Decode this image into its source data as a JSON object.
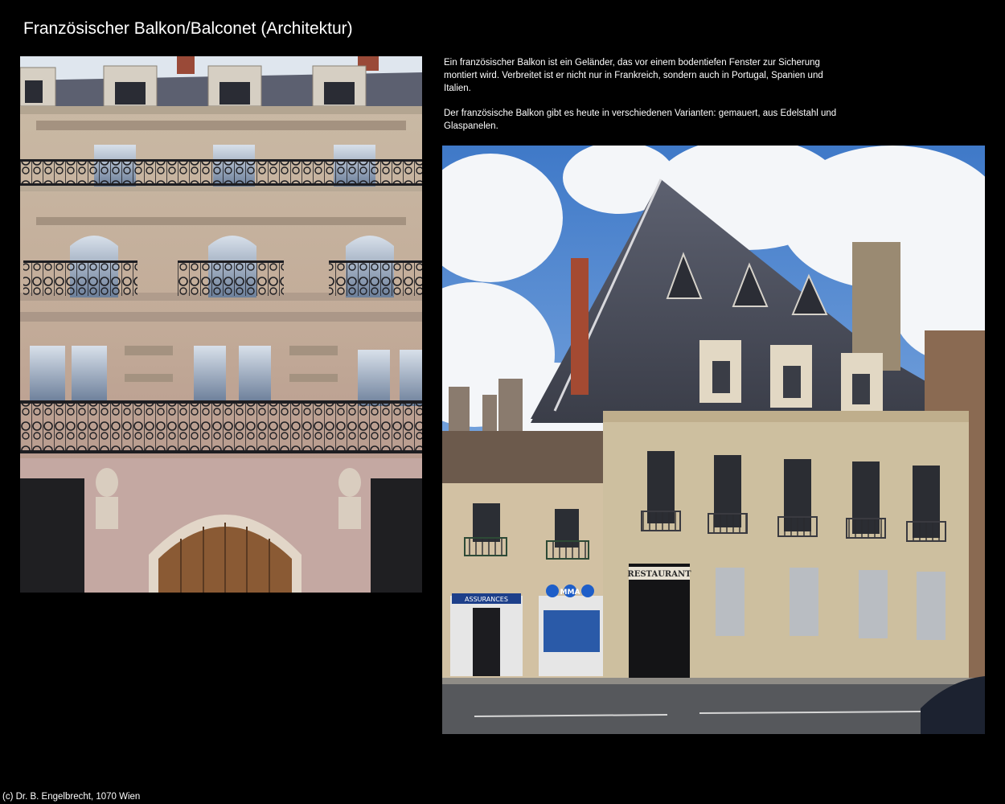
{
  "page": {
    "title": "Französischer Balkon/Balconet (Architektur)",
    "footer": "(c) Dr. B. Engelbrecht, 1070 Wien"
  },
  "description": {
    "paragraph_1": "Ein französischer Balkon ist ein Geländer, das vor einem bodentiefen Fenster zur Sicherung montiert wird. Verbreitet ist er nicht nur in Frankreich, sondern auch in Portugal, Spanien und Italien.",
    "paragraph_2": "Der französische Balkon gibt es heute in verschiedenen Varianten: gemauert, aus Edelstahl und Glaspanelen."
  },
  "photos": {
    "right": {
      "signs": {
        "restaurant": "RESTAURANT",
        "shop": "ASSURANCES",
        "logo": "MMA"
      }
    }
  }
}
